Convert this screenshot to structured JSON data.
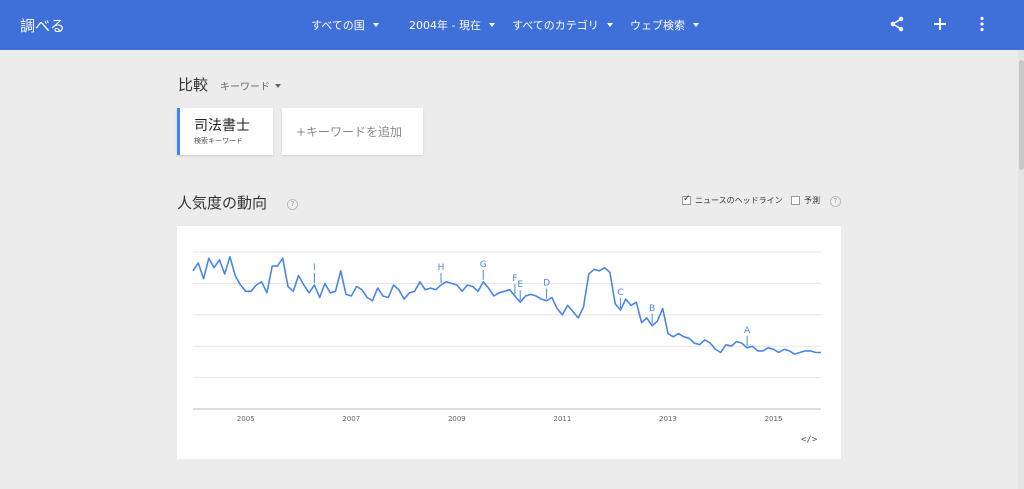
{
  "brand": {
    "title": "調べる"
  },
  "filters": [
    {
      "label": "すべての国"
    },
    {
      "label": "2004年 - 現在"
    },
    {
      "label": "すべてのカテゴリ"
    },
    {
      "label": "ウェブ検索"
    }
  ],
  "top_icons": [
    "share-icon",
    "add-icon",
    "more-vert-icon"
  ],
  "compare": {
    "title": "比較",
    "type_label": "キーワード"
  },
  "term": {
    "name": "司法書士",
    "subtitle": "検索キーワード"
  },
  "add_term": {
    "label": "+キーワードを追加"
  },
  "section": {
    "title": "人気度の動向",
    "news_label": "ニュースのヘッドライン",
    "news_checked": true,
    "forecast_label": "予測",
    "forecast_checked": false,
    "help_text": "?"
  },
  "embed_label": "</>",
  "colors": {
    "topbar": "#3f70d9",
    "series": "#4a86e8",
    "accent": "#4285f4",
    "background": "#ececec"
  },
  "chart_data": {
    "type": "line",
    "title": "",
    "xlabel": "",
    "ylabel": "",
    "x_ticks": [
      "2005",
      "2007",
      "2009",
      "2011",
      "2013",
      "2015"
    ],
    "xlim": [
      2004.0,
      2015.9
    ],
    "ylim": [
      0,
      100
    ],
    "grid": true,
    "series": [
      {
        "name": "司法書士",
        "x": [
          2004.0,
          2004.1,
          2004.2,
          2004.3,
          2004.4,
          2004.5,
          2004.6,
          2004.7,
          2004.8,
          2004.9,
          2005.0,
          2005.1,
          2005.2,
          2005.3,
          2005.4,
          2005.5,
          2005.6,
          2005.7,
          2005.8,
          2005.9,
          2006.0,
          2006.1,
          2006.2,
          2006.3,
          2006.4,
          2006.5,
          2006.6,
          2006.7,
          2006.8,
          2006.9,
          2007.0,
          2007.1,
          2007.2,
          2007.3,
          2007.4,
          2007.5,
          2007.6,
          2007.7,
          2007.8,
          2007.9,
          2008.0,
          2008.1,
          2008.2,
          2008.3,
          2008.4,
          2008.5,
          2008.6,
          2008.7,
          2008.8,
          2008.9,
          2009.0,
          2009.1,
          2009.2,
          2009.3,
          2009.4,
          2009.5,
          2009.6,
          2009.7,
          2009.8,
          2009.9,
          2010.0,
          2010.1,
          2010.2,
          2010.3,
          2010.4,
          2010.5,
          2010.6,
          2010.7,
          2010.8,
          2010.9,
          2011.0,
          2011.1,
          2011.2,
          2011.3,
          2011.4,
          2011.5,
          2011.6,
          2011.7,
          2011.8,
          2011.9,
          2012.0,
          2012.1,
          2012.2,
          2012.3,
          2012.4,
          2012.5,
          2012.6,
          2012.7,
          2012.8,
          2012.9,
          2013.0,
          2013.1,
          2013.2,
          2013.3,
          2013.4,
          2013.5,
          2013.6,
          2013.7,
          2013.8,
          2013.9,
          2014.0,
          2014.1,
          2014.2,
          2014.3,
          2014.4,
          2014.5,
          2014.6,
          2014.7,
          2014.8,
          2014.9,
          2015.0,
          2015.1,
          2015.2,
          2015.3,
          2015.4,
          2015.5,
          2015.6,
          2015.7,
          2015.8,
          2015.9
        ],
        "values": [
          88,
          93,
          83,
          96,
          90,
          95,
          86,
          97,
          85,
          79,
          75,
          75,
          79,
          81,
          74,
          91,
          91,
          96,
          78,
          75,
          85,
          79,
          74,
          79,
          71,
          80,
          74,
          75,
          88,
          73,
          72,
          78,
          76,
          71,
          69,
          77,
          72,
          71,
          79,
          76,
          70,
          74,
          75,
          81,
          76,
          77,
          76,
          79,
          81,
          80,
          79,
          75,
          79,
          78,
          75,
          81,
          77,
          72,
          74,
          75,
          76,
          72,
          68,
          72,
          73,
          72,
          70,
          69,
          71,
          64,
          60,
          66,
          62,
          58,
          65,
          86,
          89,
          88,
          90,
          87,
          67,
          63,
          70,
          66,
          68,
          55,
          58,
          53,
          56,
          64,
          48,
          46,
          48,
          46,
          45,
          42,
          41,
          44,
          42,
          38,
          36,
          41,
          40,
          43,
          42,
          39,
          40,
          37,
          37,
          39,
          38,
          36,
          38,
          37,
          35,
          36,
          37,
          37,
          36,
          36
        ]
      }
    ],
    "annotations": [
      {
        "label": "I",
        "x": 2006.3
      },
      {
        "label": "H",
        "x": 2008.7
      },
      {
        "label": "G",
        "x": 2009.5
      },
      {
        "label": "F",
        "x": 2010.1
      },
      {
        "label": "E",
        "x": 2010.2
      },
      {
        "label": "D",
        "x": 2010.7
      },
      {
        "label": "C",
        "x": 2012.1
      },
      {
        "label": "B",
        "x": 2012.7
      },
      {
        "label": "A",
        "x": 2014.5
      }
    ]
  }
}
